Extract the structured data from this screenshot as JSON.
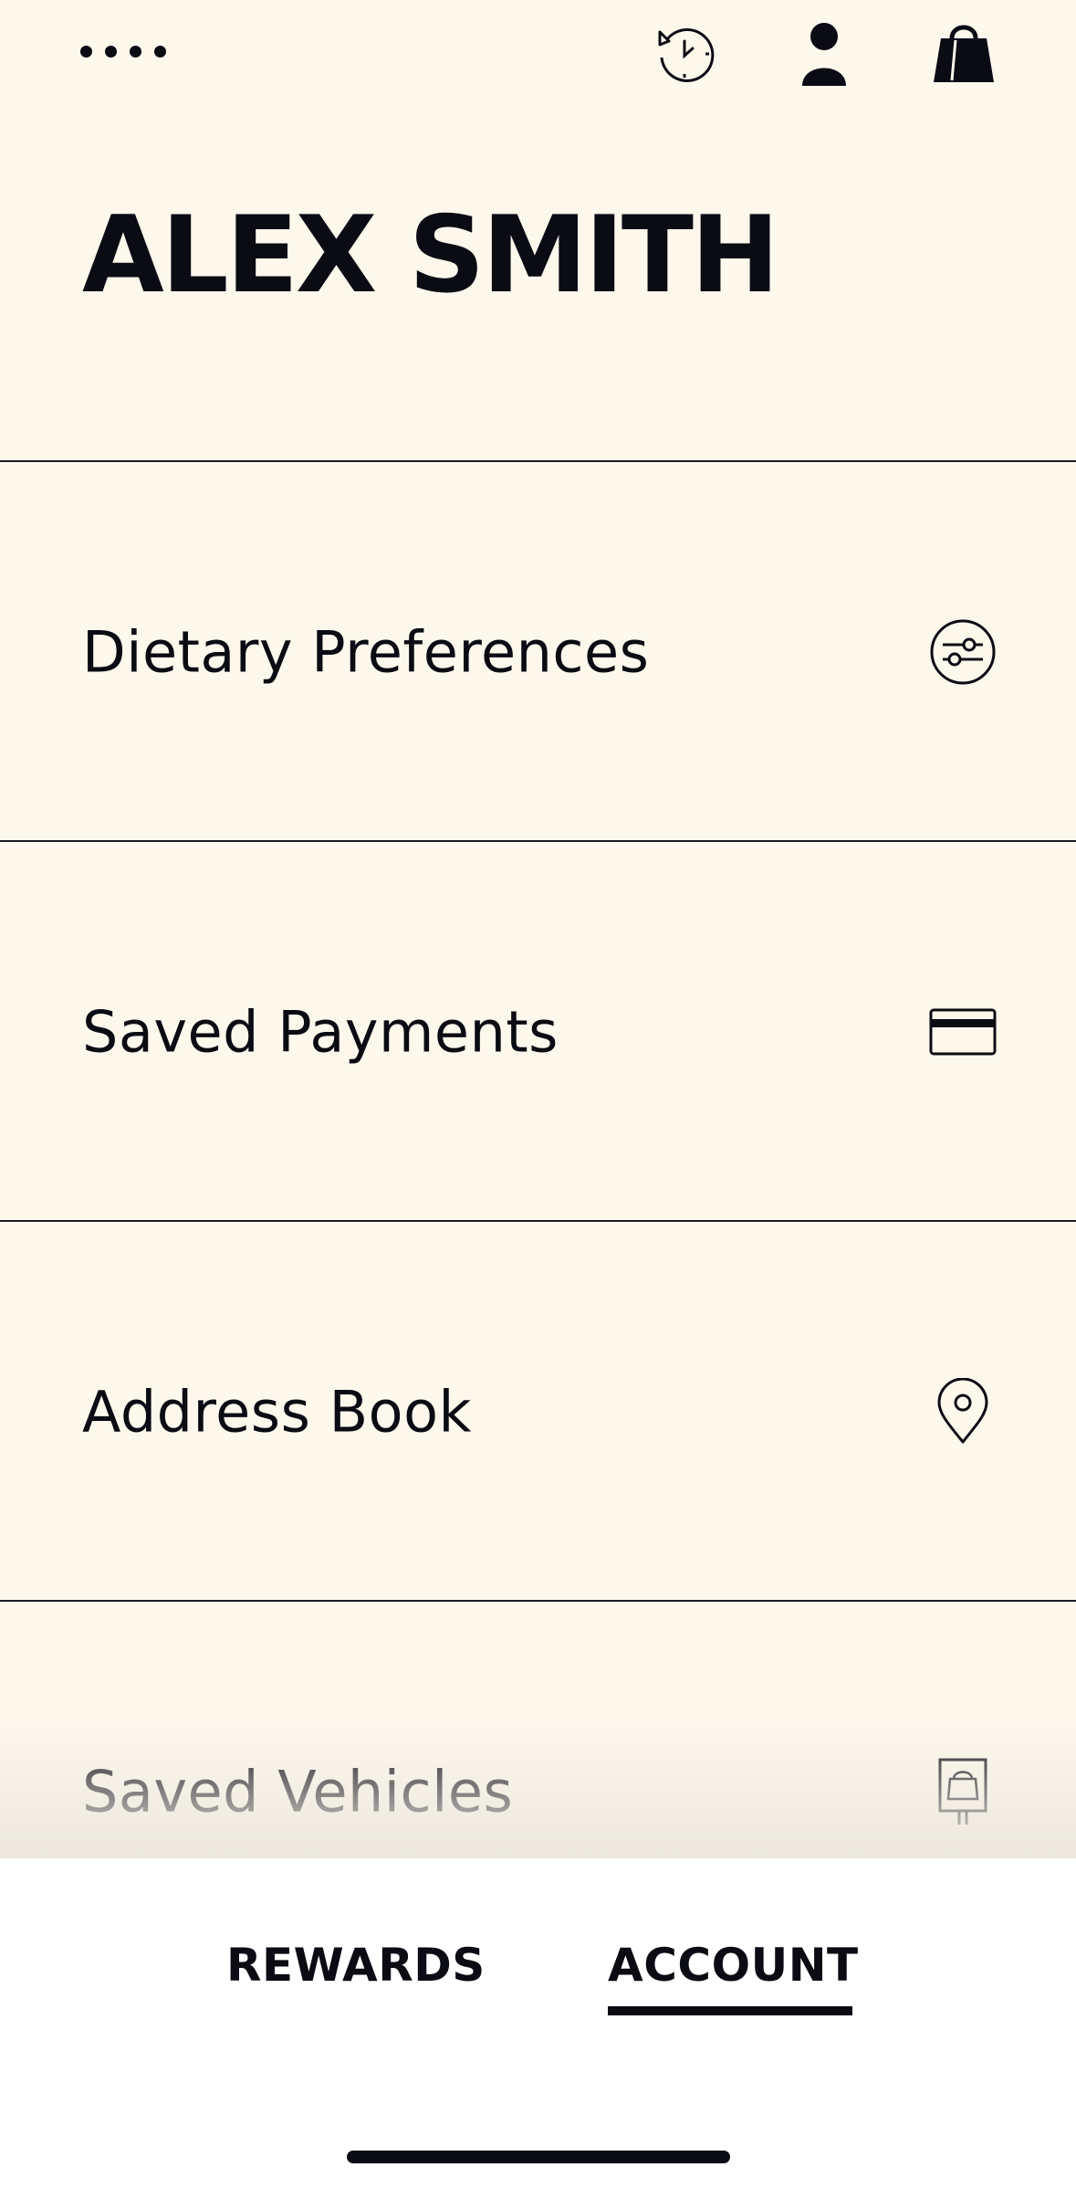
{
  "header": {
    "menu_icon": "more-dots-icon",
    "history_icon": "order-history-icon",
    "account_icon": "person-icon",
    "bag_icon": "shopping-bag-icon"
  },
  "profile": {
    "name": "ALEX SMITH"
  },
  "menu": {
    "items": [
      {
        "label": "Dietary Preferences",
        "icon": "sliders-icon"
      },
      {
        "label": "Saved Payments",
        "icon": "credit-card-icon"
      },
      {
        "label": "Address Book",
        "icon": "map-pin-icon"
      },
      {
        "label": "Saved Vehicles",
        "icon": "pickup-sign-icon"
      }
    ]
  },
  "tabs": {
    "items": [
      {
        "label": "REWARDS",
        "active": false
      },
      {
        "label": "ACCOUNT",
        "active": true
      }
    ]
  },
  "colors": {
    "background": "#fdf8ec",
    "text": "#0b0b14",
    "tabbar": "#ffffff"
  }
}
